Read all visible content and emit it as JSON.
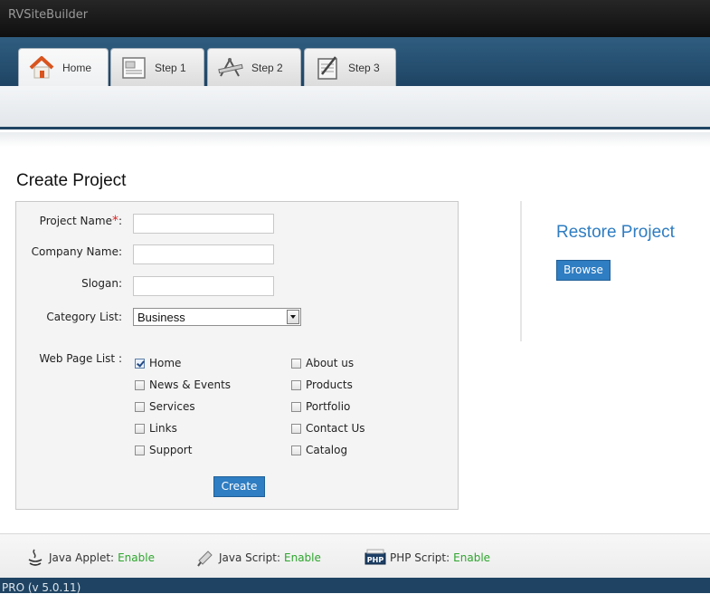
{
  "app": {
    "title": "RVSiteBuilder"
  },
  "tabs": [
    {
      "label": "Home",
      "icon": "home-icon",
      "active": true
    },
    {
      "label": "Step 1",
      "icon": "document-icon",
      "active": false
    },
    {
      "label": "Step 2",
      "icon": "drafting-tools-icon",
      "active": false
    },
    {
      "label": "Step 3",
      "icon": "checklist-icon",
      "active": false
    }
  ],
  "create": {
    "title": "Create Project",
    "project_name_label": "Project Name",
    "required_mark": "*",
    "label_colon": ":",
    "project_name_value": "",
    "company_name_label": "Company Name:",
    "company_name_value": "",
    "slogan_label": "Slogan:",
    "slogan_value": "",
    "category_label": "Category List:",
    "category_value": "Business",
    "web_page_list_label": "Web Page List :",
    "pages": [
      {
        "label": "Home",
        "checked": true
      },
      {
        "label": "About us",
        "checked": false
      },
      {
        "label": "News & Events",
        "checked": false
      },
      {
        "label": "Products",
        "checked": false
      },
      {
        "label": "Services",
        "checked": false
      },
      {
        "label": "Portfolio",
        "checked": false
      },
      {
        "label": "Links",
        "checked": false
      },
      {
        "label": "Contact Us",
        "checked": false
      },
      {
        "label": "Support",
        "checked": false
      },
      {
        "label": "Catalog",
        "checked": false
      }
    ],
    "create_button": "Create"
  },
  "restore": {
    "title": "Restore Project",
    "browse_button": "Browse"
  },
  "footer": {
    "java_applet_label": "Java Applet:",
    "java_script_label": "Java Script:",
    "php_script_label": "PHP Script:",
    "enable_text": "Enable",
    "enable_color": "#2ea52e"
  },
  "version": "PRO (v 5.0.11)",
  "colors": {
    "accent": "#2f7dc2",
    "nav": "#1f4463",
    "required": "#e02424"
  }
}
